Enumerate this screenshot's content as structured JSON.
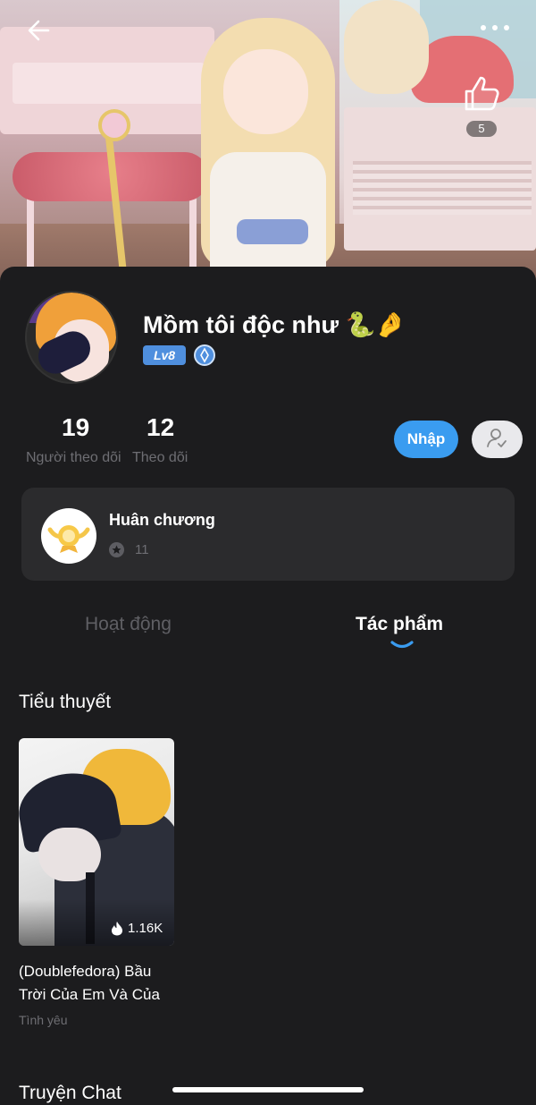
{
  "header": {
    "back_icon": "arrow-left-icon",
    "more_icon": "more-dots-icon",
    "like_icon": "thumbs-up-icon",
    "like_count": "5"
  },
  "profile": {
    "username": "Mồm tôi độc như 🐍🤌",
    "level": "Lv8",
    "verify_icon": "shield-badge-icon",
    "followers_count": "19",
    "followers_label": "Người theo dõi",
    "following_count": "12",
    "following_label": "Theo dõi",
    "nhap_button": "Nhập",
    "follow_icon": "user-check-icon"
  },
  "medals": {
    "title": "Huân chương",
    "count": "11"
  },
  "tabs": [
    {
      "label": "Hoạt động",
      "active": false
    },
    {
      "label": "Tác phẩm",
      "active": true
    }
  ],
  "novels": {
    "section_title": "Tiểu thuyết",
    "items": [
      {
        "views": "1.16K",
        "title": "(Doublefedora) Bầu Trời Của Em Và Của",
        "tag": "Tình yêu"
      }
    ]
  },
  "chat": {
    "section_title": "Truyện Chat"
  },
  "colors": {
    "background": "#1c1c1e",
    "accent": "#3a9cf0",
    "level_badge": "#4f8fde",
    "muted_text": "#6e6e73"
  }
}
